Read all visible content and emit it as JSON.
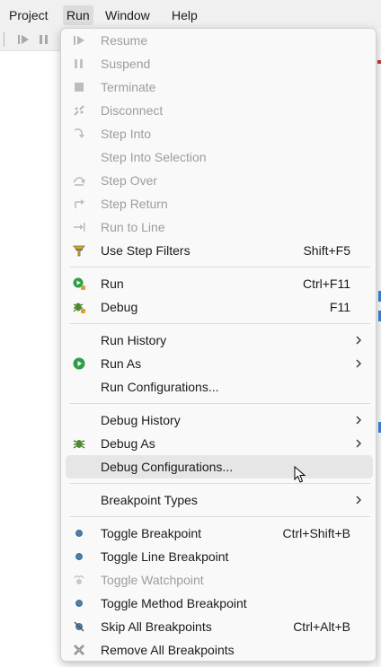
{
  "menubar": {
    "items": [
      "Project",
      "Run",
      "Window",
      "Help"
    ]
  },
  "toolbar": {
    "icons": [
      "resume-icon",
      "suspend-icon"
    ]
  },
  "run_menu": {
    "items": [
      {
        "label": "Resume",
        "shortcut": "",
        "disabled": true,
        "icon": "resume-icon"
      },
      {
        "label": "Suspend",
        "shortcut": "",
        "disabled": true,
        "icon": "suspend-icon"
      },
      {
        "label": "Terminate",
        "shortcut": "",
        "disabled": true,
        "icon": "terminate-icon"
      },
      {
        "label": "Disconnect",
        "shortcut": "",
        "disabled": true,
        "icon": "disconnect-icon"
      },
      {
        "label": "Step Into",
        "shortcut": "",
        "disabled": true,
        "icon": "step-into-icon"
      },
      {
        "label": "Step Into Selection",
        "shortcut": "",
        "disabled": true,
        "icon": ""
      },
      {
        "label": "Step Over",
        "shortcut": "",
        "disabled": true,
        "icon": "step-over-icon"
      },
      {
        "label": "Step Return",
        "shortcut": "",
        "disabled": true,
        "icon": "step-return-icon"
      },
      {
        "label": "Run to Line",
        "shortcut": "",
        "disabled": true,
        "icon": "run-to-line-icon"
      },
      {
        "label": "Use Step Filters",
        "shortcut": "Shift+F5",
        "disabled": false,
        "icon": "step-filters-icon"
      },
      {
        "label": "Run",
        "shortcut": "Ctrl+F11",
        "disabled": false,
        "icon": "run-icon"
      },
      {
        "label": "Debug",
        "shortcut": "F11",
        "disabled": false,
        "icon": "debug-bug-icon"
      },
      {
        "label": "Run History",
        "shortcut": "",
        "disabled": false,
        "icon": "",
        "submenu": true
      },
      {
        "label": "Run As",
        "shortcut": "",
        "disabled": false,
        "icon": "run-as-icon",
        "submenu": true
      },
      {
        "label": "Run Configurations...",
        "shortcut": "",
        "disabled": false,
        "icon": ""
      },
      {
        "label": "Debug History",
        "shortcut": "",
        "disabled": false,
        "icon": "",
        "submenu": true
      },
      {
        "label": "Debug As",
        "shortcut": "",
        "disabled": false,
        "icon": "debug-as-icon",
        "submenu": true
      },
      {
        "label": "Debug Configurations...",
        "shortcut": "",
        "disabled": false,
        "icon": "",
        "hovered": true
      },
      {
        "label": "Breakpoint Types",
        "shortcut": "",
        "disabled": false,
        "icon": "",
        "submenu": true
      },
      {
        "label": "Toggle Breakpoint",
        "shortcut": "Ctrl+Shift+B",
        "disabled": false,
        "icon": "breakpoint-dot-icon"
      },
      {
        "label": "Toggle Line Breakpoint",
        "shortcut": "",
        "disabled": false,
        "icon": "breakpoint-dot-icon"
      },
      {
        "label": "Toggle Watchpoint",
        "shortcut": "",
        "disabled": true,
        "icon": "watchpoint-icon"
      },
      {
        "label": "Toggle Method Breakpoint",
        "shortcut": "",
        "disabled": false,
        "icon": "breakpoint-dot-icon"
      },
      {
        "label": "Skip All Breakpoints",
        "shortcut": "Ctrl+Alt+B",
        "disabled": false,
        "icon": "skip-breakpoints-icon"
      },
      {
        "label": "Remove All Breakpoints",
        "shortcut": "",
        "disabled": false,
        "icon": "remove-breakpoints-icon"
      }
    ]
  },
  "colors": {
    "menu_background": "#f9f9f9",
    "disabled_text": "#9d9d9d",
    "hover_background": "#e6e6e6",
    "run_green": "#2e9e45",
    "breakpoint_blue": "#4a7fb0"
  }
}
